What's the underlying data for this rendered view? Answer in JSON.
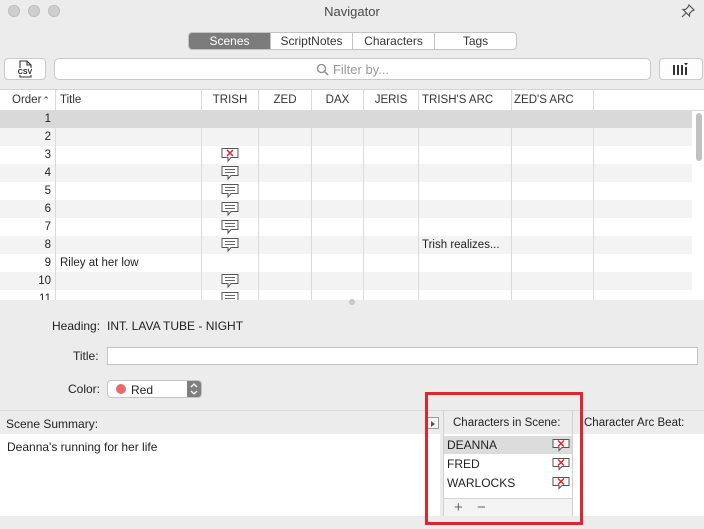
{
  "window": {
    "title": "Navigator"
  },
  "tabs": [
    {
      "label": "Scenes",
      "active": true
    },
    {
      "label": "ScriptNotes",
      "active": false
    },
    {
      "label": "Characters",
      "active": false
    },
    {
      "label": "Tags",
      "active": false
    }
  ],
  "toolbar": {
    "csv_label": "CSV",
    "filter_placeholder": "Filter by..."
  },
  "table": {
    "columns": [
      "Order",
      "Title",
      "TRISH",
      "ZED",
      "DAX",
      "JERIS",
      "TRISH'S ARC",
      "ZED'S ARC"
    ],
    "sort_column": "Order",
    "rows": [
      {
        "order": "1",
        "title": "",
        "trish": "none",
        "trish_arc": ""
      },
      {
        "order": "2",
        "title": "",
        "trish": "none",
        "trish_arc": ""
      },
      {
        "order": "3",
        "title": "",
        "trish": "bubble-x",
        "trish_arc": ""
      },
      {
        "order": "4",
        "title": "",
        "trish": "bubble",
        "trish_arc": ""
      },
      {
        "order": "5",
        "title": "",
        "trish": "bubble",
        "trish_arc": ""
      },
      {
        "order": "6",
        "title": "",
        "trish": "bubble",
        "trish_arc": ""
      },
      {
        "order": "7",
        "title": "",
        "trish": "bubble",
        "trish_arc": ""
      },
      {
        "order": "8",
        "title": "",
        "trish": "bubble",
        "trish_arc": "Trish realizes..."
      },
      {
        "order": "9",
        "title": "Riley at her low",
        "trish": "none",
        "trish_arc": ""
      },
      {
        "order": "10",
        "title": "",
        "trish": "bubble",
        "trish_arc": ""
      },
      {
        "order": "11",
        "title": "",
        "trish": "bubble",
        "trish_arc": ""
      }
    ]
  },
  "details": {
    "heading_label": "Heading:",
    "heading_value": "INT. LAVA TUBE - NIGHT",
    "title_label": "Title:",
    "title_value": "",
    "color_label": "Color:",
    "color_value": "Red",
    "color_hex": "#e76b6b"
  },
  "lower": {
    "summary_label": "Scene Summary:",
    "summary_text": "Deanna's running for her life",
    "characters_label": "Characters in Scene:",
    "arc_label": "Character Arc Beat:",
    "characters": [
      {
        "name": "DEANNA",
        "selected": true
      },
      {
        "name": "FRED",
        "selected": false
      },
      {
        "name": "WARLOCKS",
        "selected": false
      }
    ],
    "add_label": "+",
    "remove_label": "−"
  },
  "colors": {
    "highlight": "#e0262c",
    "active_tab": "#7b7b7b"
  }
}
